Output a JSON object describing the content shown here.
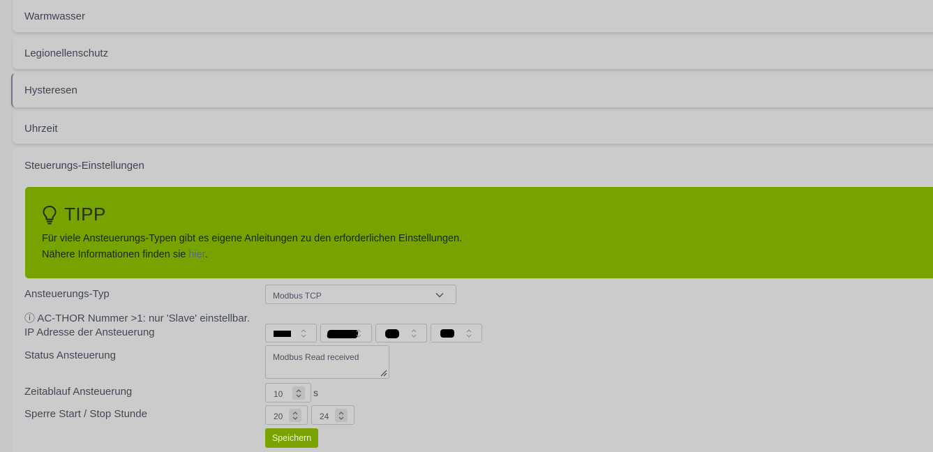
{
  "sections": {
    "warmwasser": "Warmwasser",
    "legionellenschutz": "Legionellenschutz",
    "hysteresen": "Hysteresen",
    "uhrzeit": "Uhrzeit",
    "steuerung": "Steuerungs-Einstellungen"
  },
  "tipp": {
    "title": "TIPP",
    "line1": "Für viele Ansteuerungs-Typen gibt es eigene Anleitungen zu den erforderlichen Einstellungen.",
    "line2_prefix": "Nähere Informationen finden sie ",
    "link": "hier",
    "line2_suffix": ".",
    "icon": "lightbulb-icon",
    "color": "#77a300"
  },
  "form": {
    "type_label": "Ansteuerungs-Typ",
    "type_value": "Modbus TCP",
    "note": "ⓘ AC-THOR Nummer >1: nur 'Slave' einstellbar.",
    "ip_label": "IP Adresse der Ansteuerung",
    "status_label": "Status Ansteuerung",
    "status_value": "Modbus Read received",
    "timeout_label": "Zeitablauf Ansteuerung",
    "timeout_value": "10",
    "timeout_unit": "s",
    "block_label": "Sperre Start / Stop Stunde",
    "block_start": "20",
    "block_stop": "24",
    "save_label": "Speichern"
  }
}
